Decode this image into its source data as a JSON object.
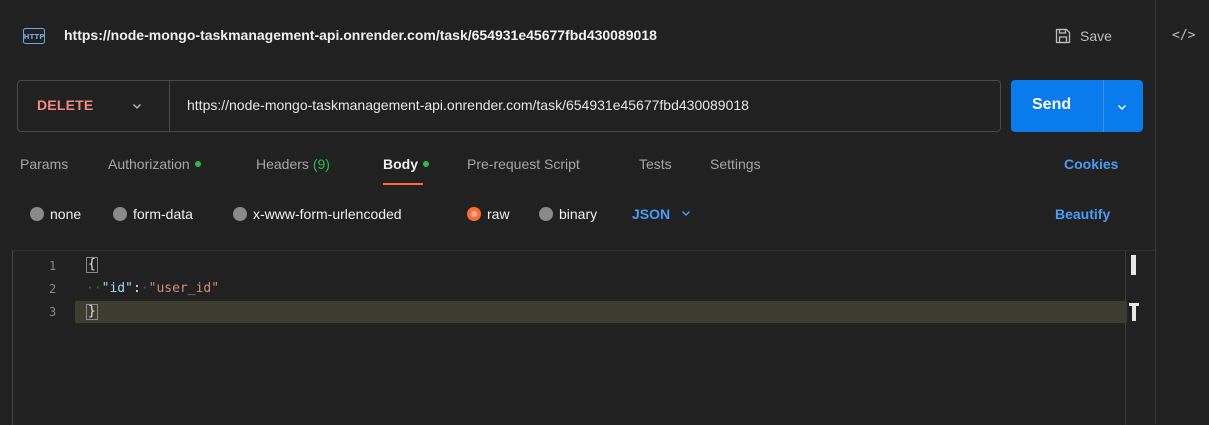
{
  "request": {
    "title": "https://node-mongo-taskmanagement-api.onrender.com/task/654931e45677fbd430089018",
    "method": "DELETE",
    "url": "https://node-mongo-taskmanagement-api.onrender.com/task/654931e45677fbd430089018"
  },
  "toolbar": {
    "save_label": "Save",
    "send_label": "Send"
  },
  "tabs": [
    {
      "label": "Params"
    },
    {
      "label": "Authorization",
      "indicator": "green-dot"
    },
    {
      "label": "Headers",
      "count": "(9)"
    },
    {
      "label": "Body",
      "indicator": "green-dot",
      "active": true
    },
    {
      "label": "Pre-request Script"
    },
    {
      "label": "Tests"
    },
    {
      "label": "Settings"
    }
  ],
  "cookies_label": "Cookies",
  "body_types": [
    {
      "label": "none",
      "selected": false
    },
    {
      "label": "form-data",
      "selected": false
    },
    {
      "label": "x-www-form-urlencoded",
      "selected": false
    },
    {
      "label": "raw",
      "selected": true
    },
    {
      "label": "binary",
      "selected": false
    }
  ],
  "raw_format": "JSON",
  "beautify_label": "Beautify",
  "editor": {
    "line_numbers": [
      "1",
      "2",
      "3"
    ],
    "line1": "{",
    "line2_key": "\"id\"",
    "line2_colon": ":",
    "line2_value": "\"user_id\"",
    "line3": "}"
  },
  "colors": {
    "method_delete": "#f28b82",
    "send_button": "#097bed",
    "active_tab_underline": "#ff6c37",
    "link_blue": "#4a9cf4",
    "indicator_green": "#2fb84c"
  },
  "icons": [
    "http-icon",
    "save-icon",
    "chevron-down-icon",
    "code-icon"
  ]
}
